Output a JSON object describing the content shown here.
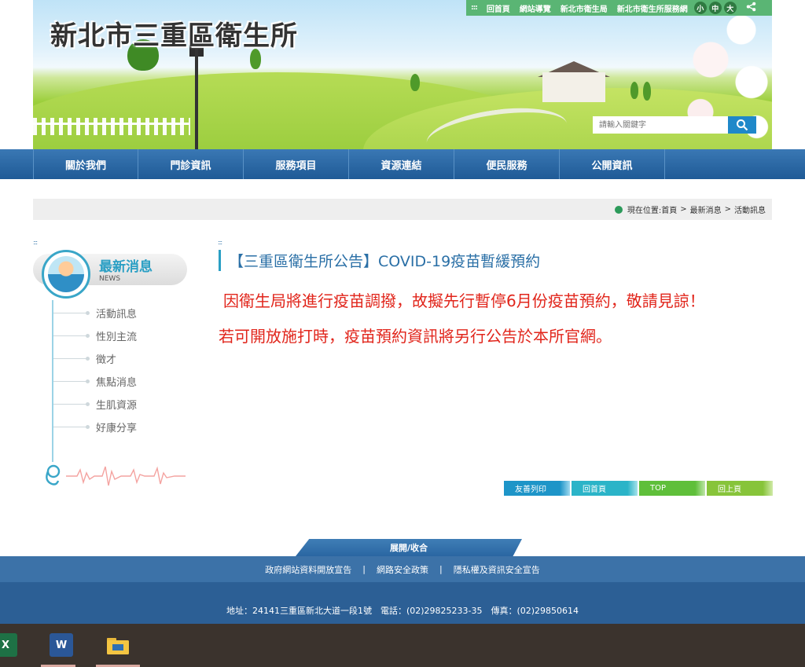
{
  "header": {
    "site_title": "新北市三重區衛生所",
    "top_links": [
      "回首頁",
      "網站導覽",
      "新北市衛生局",
      "新北市衛生所服務網"
    ],
    "font_sizes": [
      "小",
      "中",
      "大"
    ],
    "search_placeholder": "請輸入關鍵字"
  },
  "nav": [
    "關於我們",
    "門診資訊",
    "服務項目",
    "資源連結",
    "便民服務",
    "公開資訊"
  ],
  "breadcrumb": {
    "label": "現在位置:首頁",
    "items": [
      "最新消息",
      "活動訊息"
    ]
  },
  "sidebar": {
    "title": "最新消息",
    "subtitle": "NEWS",
    "items": [
      "活動訊息",
      "性別主流",
      "徵才",
      "焦點消息",
      "生肌資源",
      "好康分享"
    ]
  },
  "content": {
    "title": "【三重區衛生所公告】COVID-19疫苗暫緩預約",
    "lines": [
      "因衛生局將進行疫苗調撥，故擬先行暫停6月份疫苗預約，敬請見諒！",
      "若可開放施打時，疫苗預約資訊將另行公告於本所官網。"
    ]
  },
  "actions": {
    "print": "友善列印",
    "home": "回首頁",
    "top": "TOP",
    "back": "回上頁"
  },
  "footer": {
    "expand": "展開/收合",
    "links": [
      "政府網站資料開放宣告",
      "網路安全政策",
      "隱私權及資訊安全宣告"
    ],
    "separator": "|",
    "address": "地址：24141三重區新北大道一段1號　電話：(02)29825233-35　傳真：(02)29850614"
  },
  "taskbar": {
    "excel_letter": "X",
    "word_letter": "W"
  },
  "colors": {
    "nav": "#2a66a2",
    "accent_green": "#5ab574",
    "alert_red": "#e1251b",
    "title_blue": "#2a6fa6"
  }
}
